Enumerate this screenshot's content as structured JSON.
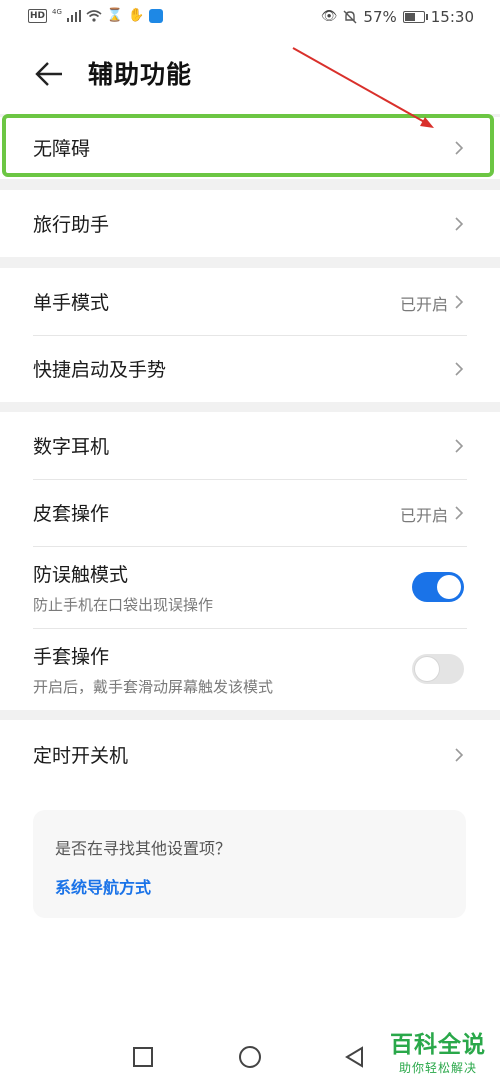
{
  "status_bar": {
    "left_badges": [
      "HD",
      "4G"
    ],
    "battery_text": "57%",
    "battery_level": 0.57,
    "time": "15:30"
  },
  "header": {
    "title": "辅助功能"
  },
  "groups": [
    {
      "items": [
        {
          "label": "无障碍"
        }
      ]
    },
    {
      "items": [
        {
          "label": "旅行助手"
        }
      ]
    },
    {
      "items": [
        {
          "label": "单手模式",
          "value": "已开启"
        },
        {
          "label": "快捷启动及手势"
        }
      ]
    },
    {
      "items": [
        {
          "label": "数字耳机"
        },
        {
          "label": "皮套操作",
          "value": "已开启"
        },
        {
          "label": "防误触模式",
          "description": "防止手机在口袋出现误操作",
          "toggle": true
        },
        {
          "label": "手套操作",
          "description": "开启后，戴手套滑动屏幕触发该模式",
          "toggle": false
        }
      ]
    },
    {
      "items": [
        {
          "label": "定时开关机"
        }
      ]
    }
  ],
  "suggestion": {
    "question": "是否在寻找其他设置项？",
    "link": "系统导航方式"
  },
  "watermark": {
    "main": "百科全说",
    "sub": "助你轻松解决"
  },
  "colors": {
    "accent": "#1a73e8",
    "highlight": "#6cc643",
    "annotation_arrow": "#d9302b",
    "watermark": "#2aa84a"
  },
  "icons": [
    "back-arrow-icon",
    "chevron-right-icon",
    "square-nav-icon",
    "circle-nav-icon",
    "triangle-back-nav-icon"
  ]
}
